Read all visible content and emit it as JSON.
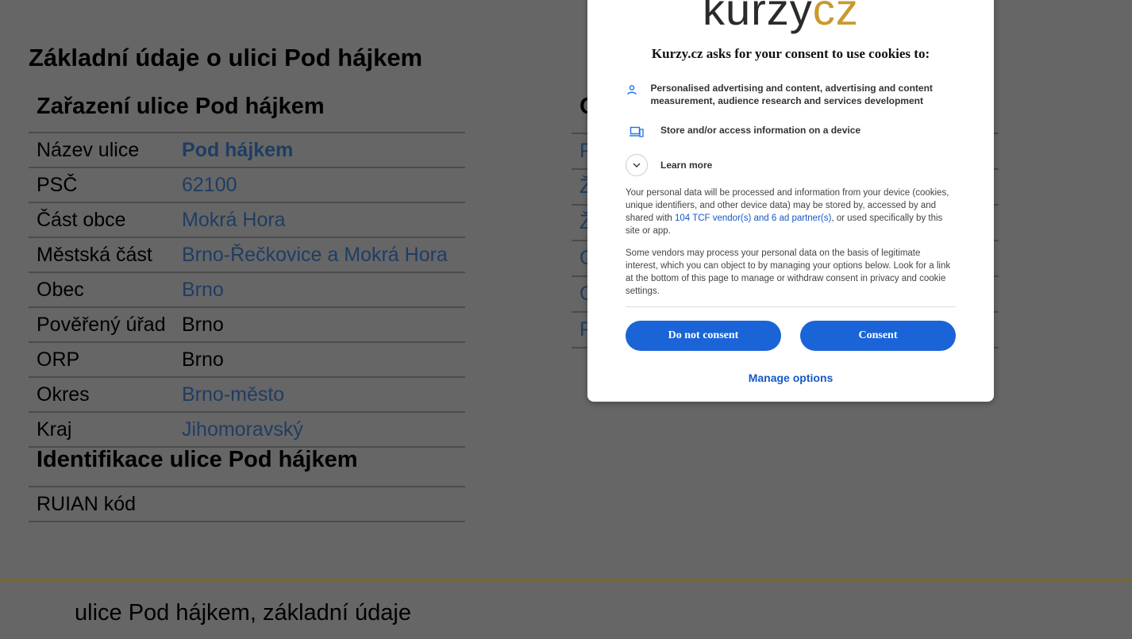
{
  "main": {
    "title": "Základní údaje o ulici Pod hájkem",
    "classification": {
      "title": "Zařazení ulice Pod hájkem",
      "rows": [
        {
          "label": "Název ulice",
          "value": "Pod hájkem"
        },
        {
          "label": "PSČ",
          "value": "62100"
        },
        {
          "label": "Část obce",
          "value": "Mokrá Hora"
        },
        {
          "label": "Městská část",
          "value": "Brno-Řečkovice a Mokrá Hora"
        },
        {
          "label": "Obec",
          "value": "Brno"
        },
        {
          "label": "Pověřený úřad",
          "value": "Brno"
        },
        {
          "label": "ORP",
          "value": "Brno"
        },
        {
          "label": "Okres",
          "value": "Brno-město"
        },
        {
          "label": "Kraj",
          "value": "Jihomoravský"
        }
      ]
    },
    "identification": {
      "title": "Identifikace ulice Pod hájkem",
      "rows": [
        {
          "label": "RUIAN kód",
          "value": ""
        }
      ]
    },
    "right_partial": {
      "title_initial": "O",
      "rows": [
        "P",
        "Ž",
        "Ž",
        "O",
        "O",
        "P"
      ]
    }
  },
  "footer": {
    "text": "ulice Pod hájkem, základní údaje",
    "border_color": "#7a6630"
  },
  "consent": {
    "logo_dark": "kurzy",
    "logo_gold": "cz",
    "title": "Kurzy.cz asks for your consent to use cookies to:",
    "purposes": [
      {
        "icon": "person-icon",
        "text": "Personalised advertising and content, advertising and content measurement, audience research and services development"
      },
      {
        "icon": "device-icon",
        "text": "Store and/or access information on a device"
      }
    ],
    "learn_more": "Learn more",
    "paragraph1_a": "Your personal data will be processed and information from your device (cookies, unique identifiers, and other device data) may be stored by, accessed by and shared with ",
    "paragraph1_link": "104 TCF vendor(s) and 6 ad partner(s)",
    "paragraph1_b": ", or used specifically by this site or app.",
    "paragraph2": "Some vendors may process your personal data on the basis of legitimate interest, which you can object to by managing your options below. Look for a link at the bottom of this page to manage or withdraw consent in privacy and cookie settings.",
    "do_not_consent": "Do not consent",
    "consent": "Consent",
    "manage_options": "Manage options",
    "accent_color": "#1a64d8",
    "logo_gold_color": "#c99a2e"
  }
}
